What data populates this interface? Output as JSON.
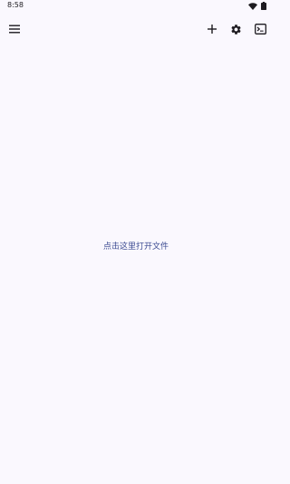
{
  "status_bar": {
    "time": "8:58",
    "icons": [
      "wifi-icon",
      "battery-icon"
    ]
  },
  "toolbar": {
    "menu_icon": "menu-icon",
    "add_icon": "plus-icon",
    "settings_icon": "gear-icon",
    "terminal_icon": "terminal-icon"
  },
  "main": {
    "open_file_text": "点击这里打开文件"
  },
  "colors": {
    "background": "#faf8fe",
    "icon": "#1d1b20",
    "link": "#3b4a91"
  }
}
